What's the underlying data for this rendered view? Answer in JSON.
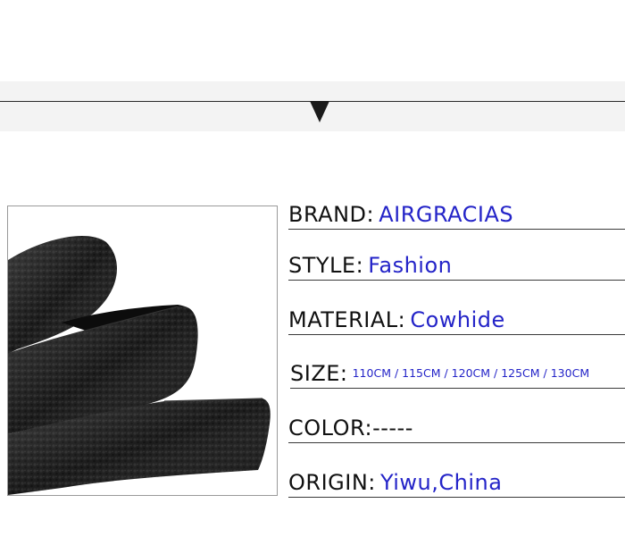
{
  "specs": {
    "brand": {
      "label": "BRAND:",
      "value": "AIRGRACIAS"
    },
    "style": {
      "label": "STYLE:",
      "value": "Fashion"
    },
    "material": {
      "label": "MATERIAL:",
      "value": "Cowhide"
    },
    "size": {
      "label": "SIZE:",
      "value": "110CM / 115CM / 120CM / 125CM / 130CM"
    },
    "color": {
      "label": "COLOR:-----"
    },
    "origin": {
      "label": "ORIGIN:",
      "value": "Yiwu,China"
    }
  },
  "colors": {
    "label_text": "#111111",
    "value_text": "#2424c8",
    "band_background": "#f3f3f3",
    "leather": "#151515"
  },
  "icons": {
    "section_marker": "down-triangle-icon"
  }
}
